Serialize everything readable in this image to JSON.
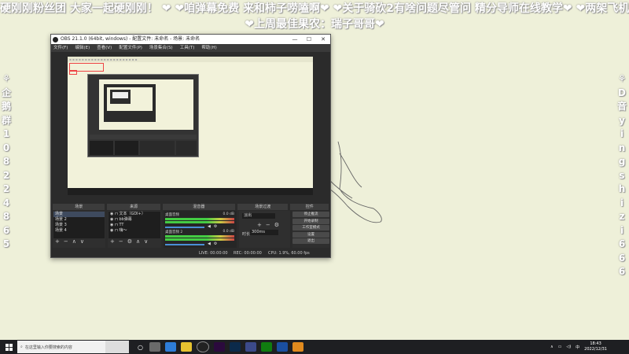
{
  "overlay": {
    "ticker_line1": "硬刚刚粉丝团 大家一起硬刚刚！ ❤ ❤咱弹幕免费 来和柿子唠嗑啊❤ ❤关于骑砍2有啥问题尽管问 精分导师在线教学❤ ❤两架飞机让拍",
    "ticker_line2": "❤上周最佳果农：瑞子哥哥❤",
    "left_vertical": [
      "⚘",
      "企",
      "鹅",
      "群",
      "1",
      "0",
      "8",
      "2",
      "2",
      "4",
      "8",
      "6",
      "5"
    ],
    "right_vertical": [
      "⚘",
      "D",
      "音",
      "y",
      "i",
      "n",
      "g",
      "s",
      "h",
      "i",
      "z",
      "i",
      "6",
      "6",
      "6"
    ]
  },
  "obs": {
    "title": "OBS 21.1.0 (64bit, windows) - 配置文件: 未命名 - 场景: 未命名",
    "menu": [
      "文件(F)",
      "编辑(E)",
      "查看(V)",
      "配置文件(P)",
      "场景集合(S)",
      "工具(T)",
      "帮助(H)"
    ],
    "docks": {
      "scenes_title": "场景",
      "sources_title": "来源",
      "mixer_title": "混音器",
      "transitions_title": "场景过渡",
      "controls_title": "控件"
    },
    "scenes": [
      "场景",
      "场景 2",
      "场景 3",
      "场景 4"
    ],
    "sources": [
      "文本（GDI+）",
      "bb弹幕",
      "TT",
      "嗨～"
    ],
    "mixer": [
      {
        "name": "桌面音频",
        "level": "0.0 dB"
      },
      {
        "name": "桌面音频 2",
        "level": "0.0 dB"
      }
    ],
    "transition": {
      "type": "淡出",
      "duration_label": "时长",
      "duration": "300ms"
    },
    "controls": [
      "停止推流",
      "开始录制",
      "工作室模式",
      "设置",
      "退出"
    ],
    "status": {
      "live": "LIVE: 00:00:00",
      "rec": "REC: 00:00:00",
      "cpu": "CPU: 1.9%, 60.00 fps"
    }
  },
  "taskbar": {
    "search_placeholder": "在这里输入你要搜索的内容",
    "time": "18:43",
    "date": "2022/12/31"
  }
}
